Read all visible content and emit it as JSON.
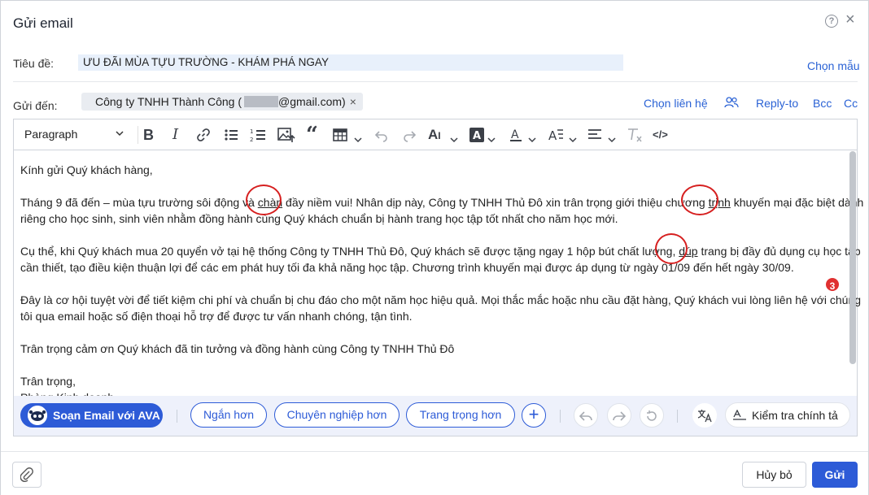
{
  "dialog": {
    "title": "Gửi email",
    "help_glyph": "?",
    "close_glyph": "×"
  },
  "subject": {
    "label": "Tiêu đề:",
    "value": "ƯU ĐÃI MÙA TỰU TRƯỜNG - KHÁM PHÁ NGAY",
    "choose_template": "Chọn mẫu"
  },
  "recipient": {
    "label": "Gửi đến:",
    "chip_prefix": "Công ty TNHH Thành Công (",
    "chip_suffix": "@gmail.com)",
    "chip_remove": "×",
    "choose_contact": "Chọn liên hệ",
    "reply_to": "Reply-to",
    "bcc": "Bcc",
    "cc": "Cc"
  },
  "toolbar": {
    "paragraph": "Paragraph",
    "source_code": "</>"
  },
  "body": {
    "greeting": "Kính gửi Quý khách hàng,",
    "p1_a": "Tháng 9 đã đến – mùa tựu trường sôi động và ",
    "p1_err1": "chàn",
    "p1_b": " đầy niềm vui! Nhân dịp này, Công ty TNHH Thủ Đô xin trân trọng giới thiệu chương ",
    "p1_err2": "trịnh",
    "p1_c": " khuyến mại đặc biệt dành",
    "p1_d": "riêng cho học sinh, sinh viên nhằm đồng hành cùng Quý khách chuẩn bị hành trang học tập tốt nhất cho năm học mới.",
    "p2_a": "Cụ thể, khi Quý khách mua 20 quyển vở tại hệ thống Công ty TNHH Thủ Đô, Quý khách sẽ được tặng ngay 1 hộp bút chất lượng, ",
    "p2_err": "dúp",
    "p2_b": " trang bị đầy đủ dụng cụ học tập",
    "p2_c": "cần thiết, tạo điều kiện thuận lợi để các em phát huy tối đa khả năng học tập. Chương trình khuyến mại được áp dụng từ ngày 01/09 đến hết ngày 30/09.",
    "p3_a": "Đây là cơ hội tuyệt vời để tiết kiệm chi phí và chuẩn bị chu đáo cho một năm học hiệu quả. Mọi thắc mắc hoặc nhu cầu đặt hàng, Quý khách vui lòng liên hệ với chúng",
    "p3_b": "tôi qua email hoặc số điện thoại hỗ trợ để được tư vấn nhanh chóng, tận tình.",
    "p4": "Trân trọng cảm ơn Quý khách đã tin tưởng và đồng hành cùng Công ty TNHH Thủ Đô",
    "closing": "Trân trọng,",
    "closing_cut": "Phòng Kinh doanh"
  },
  "ai_bar": {
    "ava": "Soạn Email với AVA",
    "shorter": "Ngắn hơn",
    "professional": "Chuyên nghiệp hơn",
    "formal": "Trang trọng hơn",
    "plus": "+",
    "spellcheck": "Kiểm tra chính tả",
    "spell_count": "3"
  },
  "footer": {
    "cancel": "Hủy bỏ",
    "send": "Gửi"
  }
}
